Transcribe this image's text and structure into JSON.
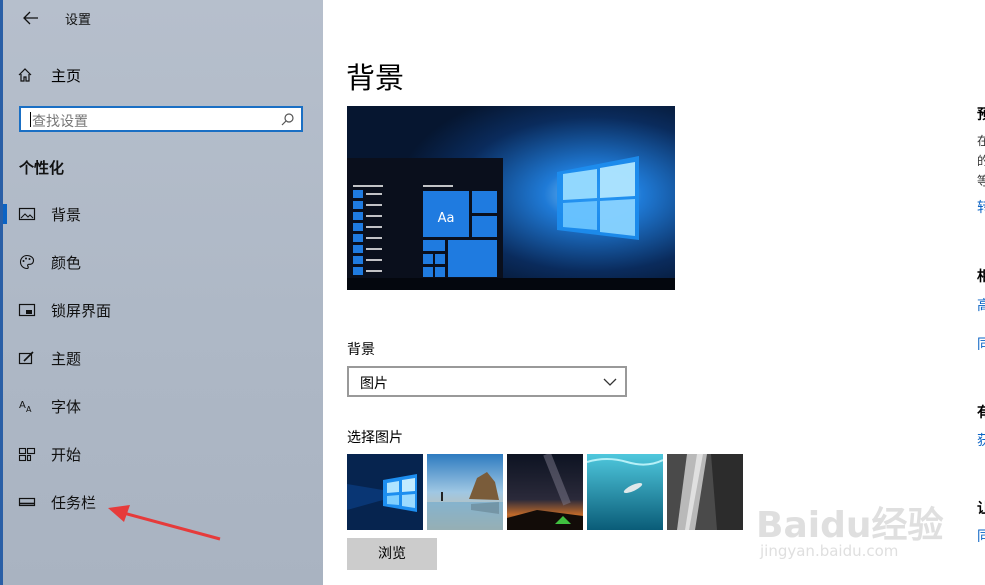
{
  "app": {
    "title": "设置"
  },
  "sidebar": {
    "home_label": "主页",
    "search_placeholder": "查找设置",
    "section_title": "个性化",
    "items": [
      {
        "label": "背景",
        "icon": "picture-icon",
        "selected": true
      },
      {
        "label": "颜色",
        "icon": "palette-icon",
        "selected": false
      },
      {
        "label": "锁屏界面",
        "icon": "lock-screen-icon",
        "selected": false
      },
      {
        "label": "主题",
        "icon": "theme-icon",
        "selected": false
      },
      {
        "label": "字体",
        "icon": "font-icon",
        "selected": false
      },
      {
        "label": "开始",
        "icon": "start-icon",
        "selected": false
      },
      {
        "label": "任务栏",
        "icon": "taskbar-icon",
        "selected": false
      }
    ]
  },
  "main": {
    "title": "背景",
    "preview_tile_text": "Aa",
    "background_label": "背景",
    "background_value": "图片",
    "choose_picture_label": "选择图片",
    "thumbnails": [
      "windows-hero-thumbnail",
      "beach-rock-thumbnail",
      "night-sky-tent-thumbnail",
      "underwater-swimmer-thumbnail",
      "rock-cliff-thumbnail"
    ],
    "browse_label": "浏览"
  },
  "right_column": {
    "fragments": [
      "预",
      "在",
      "的",
      "等",
      "转",
      "相",
      "高",
      "同",
      "有",
      "获",
      "让",
      "同"
    ]
  },
  "watermark": {
    "logo": "Baidu经验",
    "url": "jingyan.baidu.com"
  },
  "colors": {
    "accent": "#0b63c4",
    "sidebar_bg": "#b1bbc8",
    "annotation_arrow": "#e63b3b"
  }
}
